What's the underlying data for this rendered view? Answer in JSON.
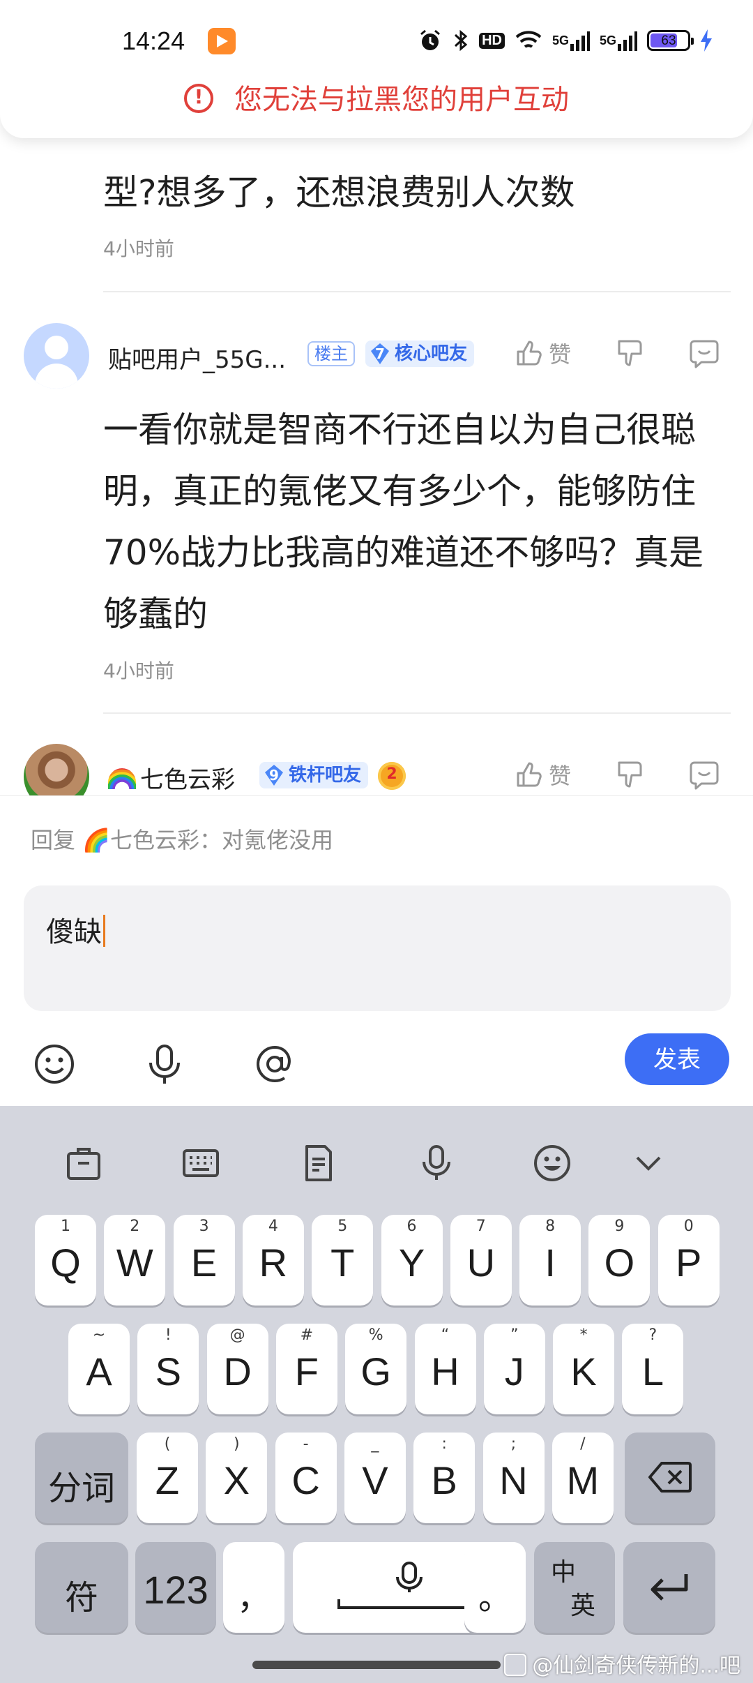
{
  "status_bar": {
    "time": "14:24",
    "battery": "63",
    "network_1": "5G",
    "network_2": "5G",
    "hd": "HD",
    "icons": [
      "app-badge-icon",
      "alarm-icon",
      "bluetooth-icon",
      "hd-icon",
      "wifi-icon",
      "signal-icon",
      "signal-icon",
      "battery-icon",
      "charging-icon"
    ]
  },
  "toast": {
    "message": "您无法与拉黑您的用户互动",
    "color": "#e0403a"
  },
  "thread": {
    "prev_line": "型?想多了，还想浪费别人次数",
    "prev_time": "4小时前",
    "comments": [
      {
        "username": "贴吧用户_55G...",
        "owner_tag": "楼主",
        "level": "7",
        "level_title": "核心吧友",
        "like_label": "赞",
        "lines": [
          "一看你就是智商不行还自以为自己很聪",
          "明，真正的氪佬又有多少个，能够防住",
          "70%战力比我高的难道还不够吗？真是",
          "够蠢的"
        ],
        "time": "4小时前"
      },
      {
        "username": "七色云彩",
        "level": "9",
        "level_title": "铁杆吧友",
        "medal": "2",
        "like_label": "赞"
      }
    ]
  },
  "reply": {
    "hint": "回复 🌈七色云彩：对氪佬没用",
    "input_value": "傻缺",
    "send_label": "发表",
    "accent": "#3d6ef5"
  },
  "keyboard": {
    "row1": [
      [
        "1",
        "Q"
      ],
      [
        "2",
        "W"
      ],
      [
        "3",
        "E"
      ],
      [
        "4",
        "R"
      ],
      [
        "5",
        "T"
      ],
      [
        "6",
        "Y"
      ],
      [
        "7",
        "U"
      ],
      [
        "8",
        "I"
      ],
      [
        "9",
        "O"
      ],
      [
        "0",
        "P"
      ]
    ],
    "row2": [
      [
        "~",
        "A"
      ],
      [
        "!",
        "S"
      ],
      [
        "@",
        "D"
      ],
      [
        "#",
        "F"
      ],
      [
        "%",
        "G"
      ],
      [
        "“",
        "H"
      ],
      [
        "”",
        "J"
      ],
      [
        "*",
        "K"
      ],
      [
        "?",
        "L"
      ]
    ],
    "row3": [
      [
        "(",
        "Z"
      ],
      [
        ")",
        "X"
      ],
      [
        "-",
        "C"
      ],
      [
        "_",
        "V"
      ],
      [
        ":",
        "B"
      ],
      [
        ";",
        "N"
      ],
      [
        "/",
        "M"
      ]
    ],
    "segment_label": "分词",
    "symbol_label": "符",
    "numeric_label": "123",
    "comma": "，",
    "period": "。",
    "lang_top": "中",
    "lang_bottom": "英"
  },
  "watermark": "@仙剑奇侠传新的...吧"
}
